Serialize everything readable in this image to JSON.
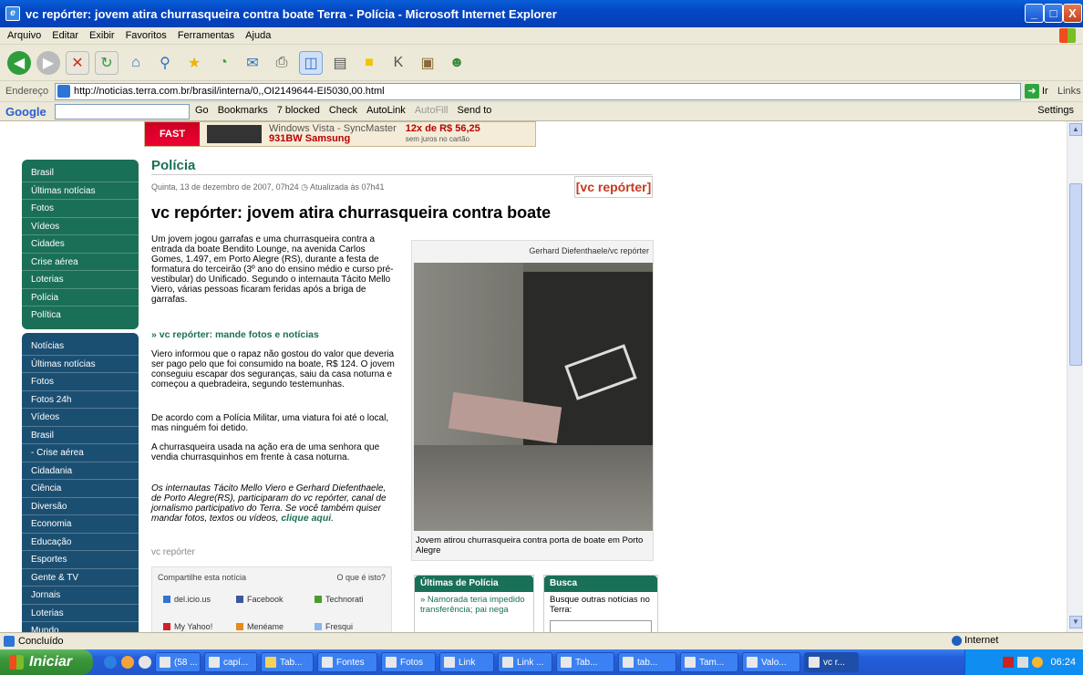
{
  "window": {
    "title": "vc repórter: jovem atira churrasqueira contra boate Terra - Polícia - Microsoft Internet Explorer",
    "minimize": "_",
    "maximize": "□",
    "close": "X"
  },
  "menu": [
    "Arquivo",
    "Editar",
    "Exibir",
    "Favoritos",
    "Ferramentas",
    "Ajuda"
  ],
  "address": {
    "label": "Endereço",
    "url": "http://noticias.terra.com.br/brasil/interna/0,,OI2149644-EI5030,00.html",
    "go": "Ir",
    "links": "Links"
  },
  "googlebar": {
    "logo": "Google",
    "go": "Go",
    "bookmarks": "Bookmarks",
    "blocked": "7 blocked",
    "check": "Check",
    "autolink": "AutoLink",
    "autofill": "AutoFill",
    "sendto": "Send to",
    "settings": "Settings"
  },
  "banner": {
    "text1": "Windows Vista - SyncMaster",
    "text2": "931BW Samsung",
    "price": "12x de R$ 56,25",
    "note": "sem juros no cartão"
  },
  "sidebar": {
    "top": [
      "Brasil",
      "Últimas notícias",
      "Fotos",
      "Vídeos",
      "Cidades",
      "Crise aérea",
      "Loterias",
      "Polícia",
      "Política"
    ],
    "bottom": [
      "Notícias",
      "Últimas notícias",
      "Fotos",
      "Fotos 24h",
      "Vídeos",
      "Brasil",
      "- Crise aérea",
      "Cidadania",
      "Ciência",
      "Diversão",
      "Economia",
      "Educação",
      "Esportes",
      "Gente & TV",
      "Jornais",
      "Loterias",
      "Mundo"
    ]
  },
  "article": {
    "section": "Polícia",
    "dateline": "Quinta, 13 de dezembro de 2007, 07h24 ◷ Atualizada às 07h41",
    "vc_logo": "[vc repórter]",
    "headline": "vc repórter: jovem atira churrasqueira contra boate",
    "p1": "Um jovem jogou garrafas e uma churrasqueira contra a entrada da boate Bendito Lounge, na avenida Carlos Gomes, 1.497, em Porto Alegre (RS), durante a festa de formatura do terceirão (3º ano do ensino médio e curso pré-vestibular) do Unificado. Segundo o internauta Tácito Mello Viero, várias pessoas ficaram feridas após a briga de garrafas.",
    "link_send": "» vc repórter: mande fotos e notícias",
    "p2": "Viero informou que o rapaz não gostou do valor que deveria ser pago pelo que foi consumido na boate, R$ 124. O jovem conseguiu escapar dos seguranças, saiu da casa noturna e começou a quebradeira, segundo testemunhas.",
    "p3": "De acordo com a Polícia Militar, uma viatura foi até o local, mas ninguém foi detido.",
    "p4": "A churrasqueira usada na ação era de uma senhora que vendia churrasquinhos em frente à casa noturna.",
    "p5": "Os internautas Tácito Mello Viero e Gerhard Diefenthaele, de Porto Alegre(RS), participaram do vc repórter, canal de jornalismo participativo do Terra. Se você também quiser mandar fotos, textos ou vídeos,",
    "p5_link": "clique aqui",
    "signature": "vc repórter",
    "photo_credit": "Gerhard Diefenthaele/vc repórter",
    "photo_caption": "Jovem atirou churrasqueira contra porta de boate em Porto Alegre"
  },
  "share": {
    "title": "Compartilhe esta notícia",
    "what": "O que é isto?",
    "items": [
      "del.icio.us",
      "Facebook",
      "Technorati",
      "My Yahoo!",
      "Menéame",
      "Fresqui"
    ]
  },
  "related": {
    "title": "Últimas de Polícia",
    "text": "» Namorada teria impedido transferência; pai nega"
  },
  "search": {
    "title": "Busca",
    "text": "Busque outras notícias no Terra:"
  },
  "status": {
    "text": "Concluído",
    "zone": "Internet"
  },
  "taskbar": {
    "start": "Iniciar",
    "buttons": [
      "(58 ...",
      "capí...",
      "Tab...",
      "Fontes",
      "Fotos",
      "Link",
      "Link ...",
      "Tab...",
      "tab...",
      "Tam...",
      "Valo...",
      "vc r..."
    ],
    "clock": "06:24"
  }
}
